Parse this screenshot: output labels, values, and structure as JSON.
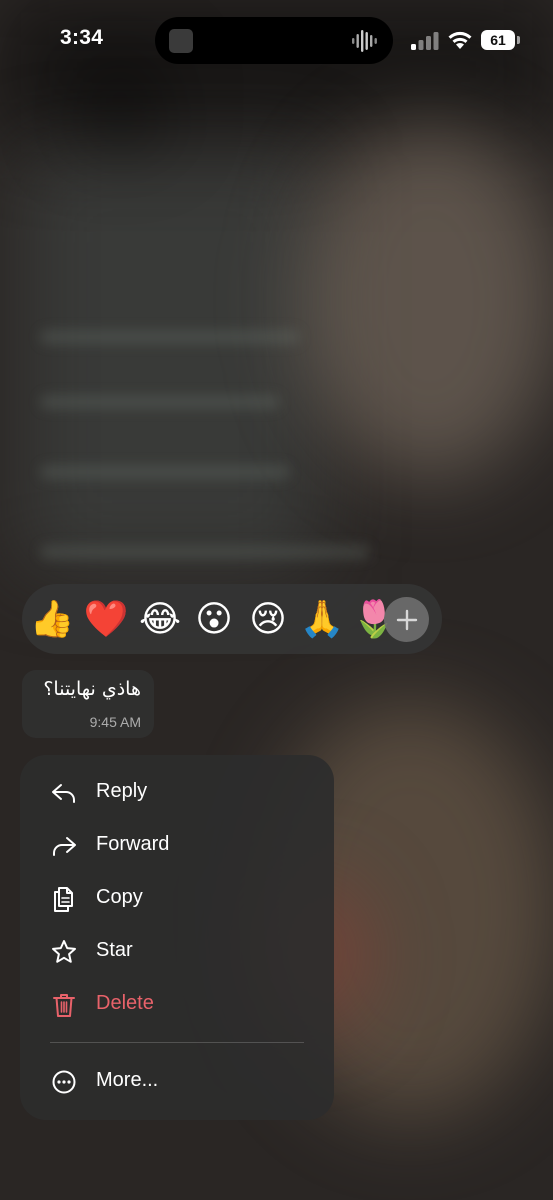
{
  "status_bar": {
    "time": "3:34",
    "battery_level": "61",
    "signal_icon": "cellular-signal-icon",
    "wifi_icon": "wifi-icon"
  },
  "reactions": {
    "emojis": [
      "👍",
      "❤️",
      "😂",
      "😮",
      "😢",
      "🙏",
      "🌷"
    ],
    "add_icon": "plus-icon"
  },
  "message": {
    "text": "هاذي نهايتنا؟",
    "time": "9:45 AM"
  },
  "menu": {
    "items": [
      {
        "label": "Reply",
        "icon": "reply-icon"
      },
      {
        "label": "Forward",
        "icon": "forward-icon"
      },
      {
        "label": "Copy",
        "icon": "copy-icon"
      },
      {
        "label": "Star",
        "icon": "star-icon"
      },
      {
        "label": "Delete",
        "icon": "trash-icon"
      },
      {
        "label": "More...",
        "icon": "more-icon"
      }
    ],
    "danger_color": "#e8626a"
  }
}
